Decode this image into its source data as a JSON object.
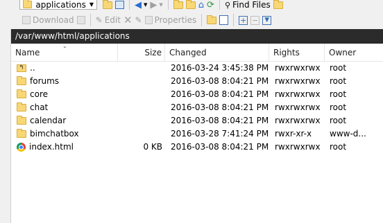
{
  "toolbar1": {
    "location": "applications",
    "find_files_label": "Find Files"
  },
  "toolbar2": {
    "download_label": "Download",
    "edit_label": "Edit",
    "properties_label": "Properties"
  },
  "path": "/var/www/html/applications",
  "columns": {
    "name": "Name",
    "size": "Size",
    "changed": "Changed",
    "rights": "Rights",
    "owner": "Owner"
  },
  "files": [
    {
      "name": "..",
      "size": "",
      "changed": "2016-03-24 3:45:38 PM",
      "rights": "rwxrwxrwx",
      "owner": "root",
      "icon": "parent-folder-icon"
    },
    {
      "name": "forums",
      "size": "",
      "changed": "2016-03-08 8:04:21 PM",
      "rights": "rwxrwxrwx",
      "owner": "root",
      "icon": "folder-icon"
    },
    {
      "name": "core",
      "size": "",
      "changed": "2016-03-08 8:04:21 PM",
      "rights": "rwxrwxrwx",
      "owner": "root",
      "icon": "folder-icon"
    },
    {
      "name": "chat",
      "size": "",
      "changed": "2016-03-08 8:04:21 PM",
      "rights": "rwxrwxrwx",
      "owner": "root",
      "icon": "folder-icon"
    },
    {
      "name": "calendar",
      "size": "",
      "changed": "2016-03-08 8:04:21 PM",
      "rights": "rwxrwxrwx",
      "owner": "root",
      "icon": "folder-icon"
    },
    {
      "name": "bimchatbox",
      "size": "",
      "changed": "2016-03-28 7:41:24 PM",
      "rights": "rwxr-xr-x",
      "owner": "www-d...",
      "icon": "folder-icon"
    },
    {
      "name": "index.html",
      "size": "0 KB",
      "changed": "2016-03-08 8:04:21 PM",
      "rights": "rwxrwxrwx",
      "owner": "root",
      "icon": "chrome-icon"
    }
  ]
}
